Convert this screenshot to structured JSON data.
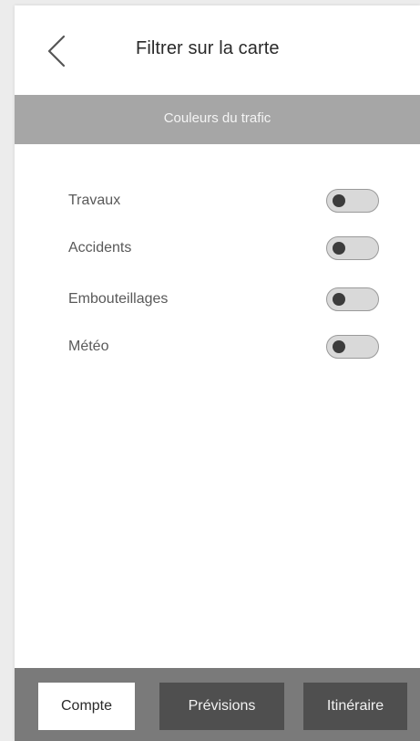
{
  "header": {
    "title": "Filtrer sur la carte",
    "back_icon": "chevron-left-icon"
  },
  "section": {
    "title": "Couleurs du trafic"
  },
  "filters": [
    {
      "label": "Travaux",
      "enabled": false
    },
    {
      "label": "Accidents",
      "enabled": false
    },
    {
      "label": "Embouteillages",
      "enabled": false
    },
    {
      "label": "Météo",
      "enabled": false
    }
  ],
  "bottom_nav": {
    "account_label": "Compte",
    "forecast_label": "Prévisions",
    "route_label": "Itinéraire"
  },
  "colors": {
    "section_bar": "#a6a6a6",
    "bottom_bar": "#7a7a7a",
    "active_button": "#ffffff",
    "inactive_button": "#4f4f4f"
  }
}
